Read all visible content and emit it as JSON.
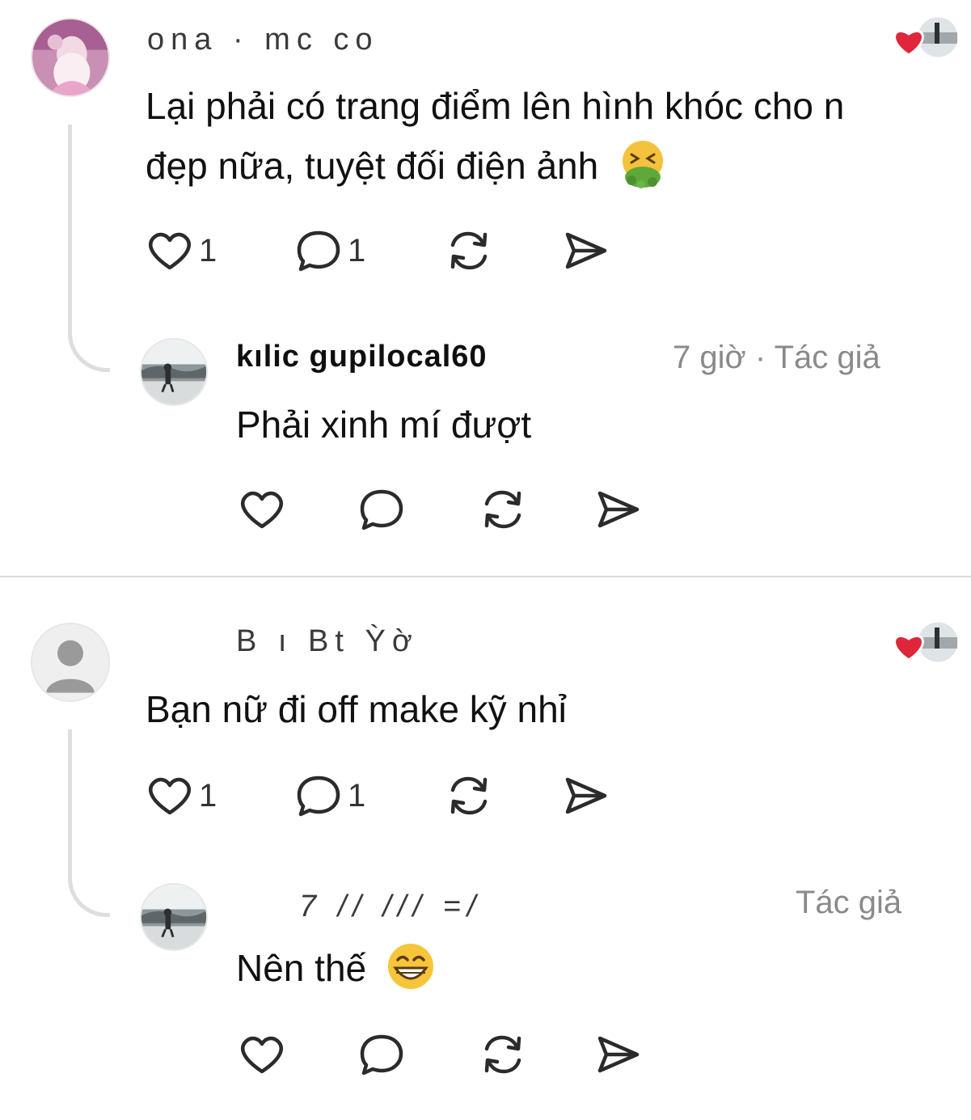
{
  "colors": {
    "heart_red": "#e0263a",
    "text": "#111111",
    "muted": "#8a8a8a",
    "icon": "#2b2b2b",
    "divider": "#dcdcdc"
  },
  "threads": [
    {
      "top_comment": {
        "username": "ona  ·  mc   co",
        "text_line1": "Lại phải có trang điểm lên hình khóc cho n",
        "text_line2": "đẹp nữa, tuyệt đối điện ảnh",
        "emoji": "nauseated-face-icon",
        "like_count": "1",
        "reply_count": "1",
        "author_liked": true
      },
      "reply": {
        "username": "kılic gupilocal60",
        "time": "7 giờ",
        "separator": "·",
        "author_tag": "Tác giả",
        "text": "Phải xinh mí đượt"
      }
    },
    {
      "top_comment": {
        "username": "B   ı    Bt      Ỳờ",
        "text_line1": "Bạn nữ đi off make kỹ nhỉ",
        "like_count": "1",
        "reply_count": "1",
        "author_liked": true
      },
      "reply": {
        "username": "7    //    ///   =/",
        "author_tag": "Tác giả",
        "text": "Nên thế",
        "emoji": "grinning-face-icon"
      }
    }
  ]
}
